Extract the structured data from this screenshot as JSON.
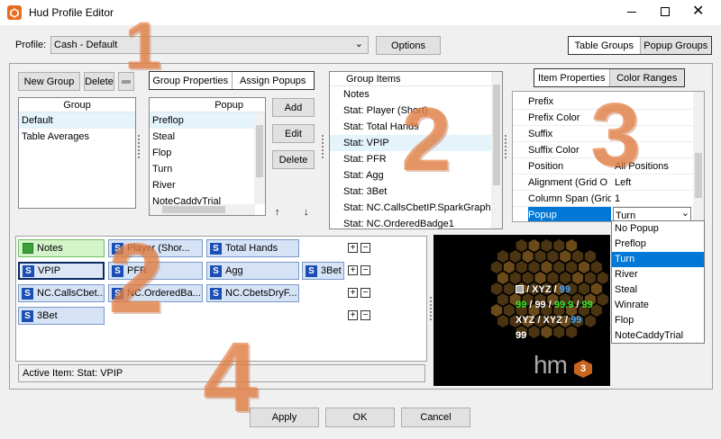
{
  "window": {
    "title": "Hud Profile Editor",
    "colors": {
      "accent": "#0078d7",
      "hud_green": "#2ee82e",
      "hud_blue": "#3fa6ff",
      "orange": "#e88a4f"
    }
  },
  "profile": {
    "label": "Profile:",
    "value": "Cash - Default",
    "options_button": "Options"
  },
  "top_toggle": {
    "table_groups": "Table Groups",
    "popup_groups": "Popup Groups"
  },
  "group_panel": {
    "new_group": "New Group",
    "delete": "Delete",
    "column_header": "Group",
    "items": [
      "Default",
      "Table Averages"
    ]
  },
  "props_toggle": {
    "group_properties": "Group Properties",
    "assign_popups": "Assign Popups"
  },
  "popup_list": {
    "column_header": "Popup",
    "items": [
      "Preflop",
      "Steal",
      "Flop",
      "Turn",
      "River",
      "NoteCaddyTrial"
    ],
    "add": "Add",
    "edit": "Edit",
    "delete": "Delete",
    "up": "↑",
    "down": "↓"
  },
  "group_items": {
    "header": "Group Items",
    "items": [
      "Notes",
      "Stat: Player (Short)",
      "Stat: Total Hands",
      "Stat: VPIP",
      "Stat: PFR",
      "Stat: Agg",
      "Stat: 3Bet",
      "Stat: NC.CallsCbetIP.SparkGraph",
      "Stat: NC.OrderedBadge1"
    ]
  },
  "item_toggle": {
    "item_properties": "Item Properties",
    "color_ranges": "Color Ranges"
  },
  "properties": [
    {
      "key": "Prefix",
      "value": ""
    },
    {
      "key": "Prefix Color",
      "value": ""
    },
    {
      "key": "Suffix",
      "value": ""
    },
    {
      "key": "Suffix Color",
      "value": ""
    },
    {
      "key": "Position",
      "value": "All Positions"
    },
    {
      "key": "Alignment (Grid O",
      "value": "Left"
    },
    {
      "key": "Column Span (Grid",
      "value": "1"
    },
    {
      "key": "Popup",
      "value": "Turn"
    }
  ],
  "popup_dropdown": {
    "options": [
      "No Popup",
      "Preflop",
      "Turn",
      "River",
      "Steal",
      "Winrate",
      "Flop",
      "NoteCaddyTrial"
    ],
    "selected": "Turn"
  },
  "layout_chips": {
    "notes": "Notes",
    "player": "Player (Shor...",
    "total_hands": "Total Hands",
    "vpip": "VPIP",
    "pfr": "PFR",
    "agg": "Agg",
    "threebet_row": "3Bet",
    "calls_cbet": "NC.CallsCbet...",
    "ordered_badge": "NC.OrderedBa...",
    "cbets_dry": "NC.CbetsDryF...",
    "threebet": "3Bet",
    "s_glyph": "S"
  },
  "active_item": "Active Item: Stat: VPIP",
  "preview": {
    "line1a": "/ XYZ /",
    "line1b": "99",
    "line2": [
      "99",
      "/",
      "99",
      "/",
      "99.9",
      "/",
      "99"
    ],
    "line3a": "XYZ / XYZ /",
    "line3b": "99",
    "line4": "99",
    "logo": "hm",
    "logo_num": "3"
  },
  "footer": {
    "apply": "Apply",
    "ok": "OK",
    "cancel": "Cancel"
  },
  "overlay_numbers": [
    "1",
    "2",
    "3",
    "2",
    "4"
  ]
}
